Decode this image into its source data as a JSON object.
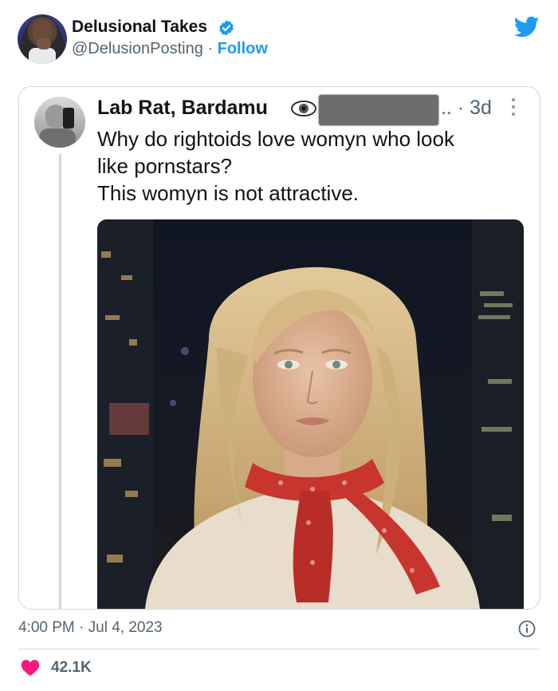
{
  "author": {
    "display_name": "Delusional Takes",
    "handle": "@DelusionPosting",
    "separator": " · ",
    "follow_label": "Follow",
    "verified_icon": "verified-badge-icon",
    "brand_icon": "twitter-bird-icon",
    "brand_color": "#1d9bf0"
  },
  "quoted": {
    "display_name": "Lab Rat, Bardamu",
    "eye_icon": "eye-icon",
    "meta": ".. · 3d",
    "more_icon": "more-vertical-icon",
    "text_lines": [
      "Why do rightoids love womyn who look",
      "like pornstars?",
      "This womyn is not attractive."
    ]
  },
  "timestamp": "4:00 PM · Jul 4, 2023",
  "info_icon": "info-icon",
  "likes": {
    "icon": "heart-icon",
    "count": "42.1K",
    "color": "#f91880"
  }
}
